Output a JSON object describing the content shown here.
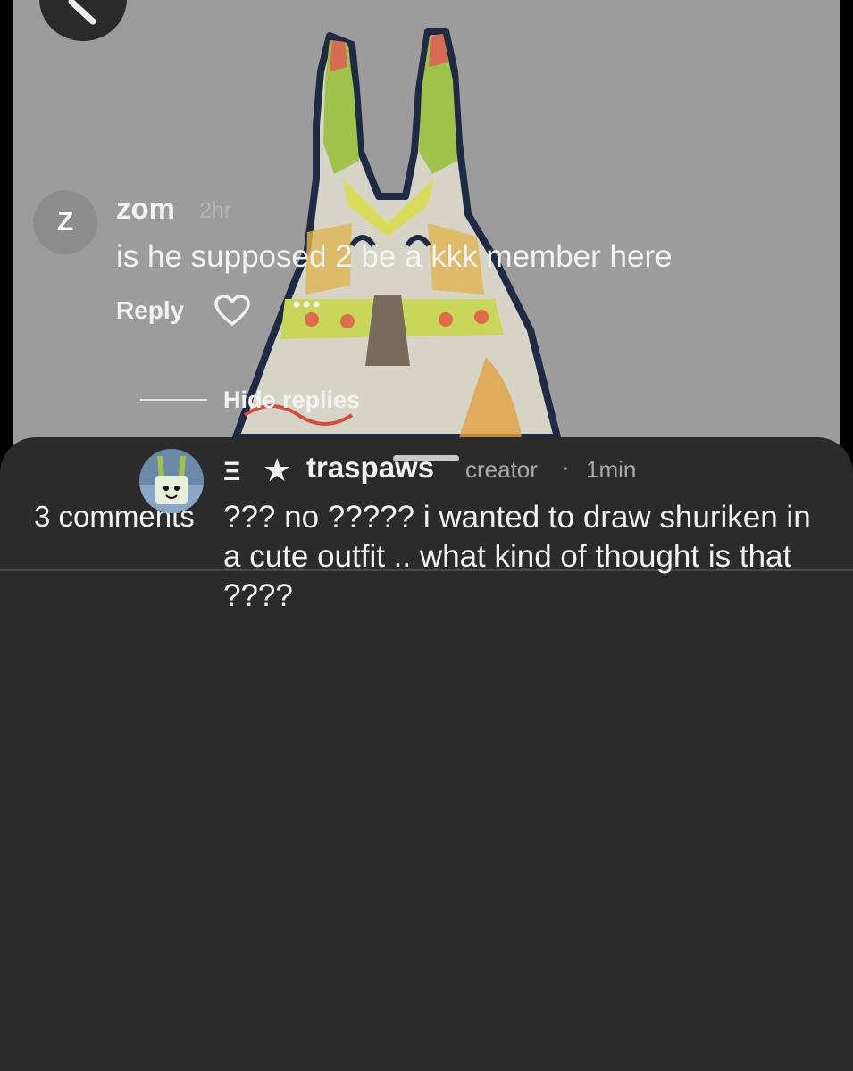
{
  "post": {
    "image_description_icon": "artwork-image",
    "background_color": "#9c9c9c"
  },
  "sheet": {
    "comments_count": "3 comments"
  },
  "comments": [
    {
      "avatar_letter": "Z",
      "username": "zom",
      "time": "2hr",
      "text": "is he supposed 2 be a kkk member here",
      "reply_label": "Reply",
      "like_icon": "heart-icon",
      "more_icon": "more-icon"
    }
  ],
  "replies_toggle": {
    "label": "Hide replies"
  },
  "replies": [
    {
      "rank_icon": "Ξ",
      "star_icon": "★",
      "username": "traspaws",
      "tag": "creator",
      "separator": "·",
      "time": "1min",
      "text": "??? no ????? i wanted to draw shuriken in a cute outfit .. what kind of thought is that ????"
    }
  ]
}
